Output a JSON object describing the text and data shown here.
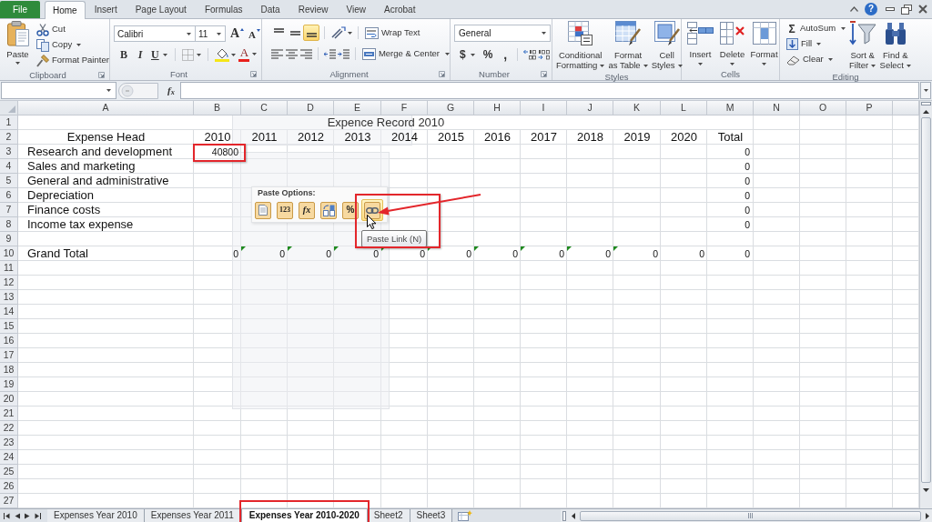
{
  "window_controls": {
    "help": "?"
  },
  "ribbon_tabs": [
    {
      "label": "File",
      "kind": "file",
      "selected": false
    },
    {
      "label": "Home",
      "kind": "tab",
      "selected": true
    },
    {
      "label": "Insert",
      "kind": "tab",
      "selected": false
    },
    {
      "label": "Page Layout",
      "kind": "tab",
      "selected": false
    },
    {
      "label": "Formulas",
      "kind": "tab",
      "selected": false
    },
    {
      "label": "Data",
      "kind": "tab",
      "selected": false
    },
    {
      "label": "Review",
      "kind": "tab",
      "selected": false
    },
    {
      "label": "View",
      "kind": "tab",
      "selected": false
    },
    {
      "label": "Acrobat",
      "kind": "tab",
      "selected": false
    }
  ],
  "ribbon": {
    "clipboard": {
      "label": "Clipboard",
      "paste": "Paste",
      "cut": "Cut",
      "copy": "Copy",
      "format_painter": "Format Painter"
    },
    "font": {
      "label": "Font",
      "font_name": "Calibri",
      "font_size": "11",
      "grow_font": "A",
      "shrink_font": "A",
      "bold": "B",
      "italic": "I",
      "underline": "U",
      "font_color": "A"
    },
    "alignment": {
      "label": "Alignment",
      "vertical_align": [
        {
          "selected": false
        },
        {
          "selected": false
        },
        {
          "selected": true
        }
      ],
      "wrap_text": "Wrap Text",
      "merge_center": "Merge & Center"
    },
    "number": {
      "label": "Number",
      "format": "General",
      "currency": "$",
      "percent": "%",
      "comma": ","
    },
    "styles": {
      "label": "Styles",
      "buttons": [
        {
          "lines": [
            "Conditional",
            "Formatting"
          ]
        },
        {
          "lines": [
            "Format",
            "as Table"
          ]
        },
        {
          "lines": [
            "Cell",
            "Styles"
          ]
        }
      ]
    },
    "cells": {
      "label": "Cells",
      "buttons": [
        "Insert",
        "Delete",
        "Format"
      ]
    },
    "editing": {
      "label": "Editing",
      "autosum_symbol": "Σ",
      "autosum": "AutoSum",
      "fill": "Fill",
      "clear": "Clear",
      "buttons": [
        {
          "lines": [
            "Sort &",
            "Filter"
          ]
        },
        {
          "lines": [
            "Find &",
            "Select"
          ]
        }
      ]
    }
  },
  "formula_bar": {
    "function_button": "f$_{x}$"
  },
  "sheet": {
    "columns": [
      "A",
      "B",
      "C",
      "D",
      "E",
      "F",
      "G",
      "H",
      "I",
      "J",
      "K",
      "L",
      "M",
      "N",
      "O",
      "P"
    ],
    "rows": [
      {
        "header": "1",
        "kind": "title",
        "title": "Expence Record 2010"
      },
      {
        "header": "2",
        "kind": "heading",
        "label": "Expense Head",
        "values": [
          {
            "text": "2010",
            "flagged": false,
            "highlighted": false
          },
          {
            "text": "2011",
            "flagged": false,
            "highlighted": false
          },
          {
            "text": "2012",
            "flagged": false,
            "highlighted": false
          },
          {
            "text": "2013",
            "flagged": false,
            "highlighted": false
          },
          {
            "text": "2014",
            "flagged": false,
            "highlighted": false
          },
          {
            "text": "2015",
            "flagged": false,
            "highlighted": false
          },
          {
            "text": "2016",
            "flagged": false,
            "highlighted": false
          },
          {
            "text": "2017",
            "flagged": false,
            "highlighted": false
          },
          {
            "text": "2018",
            "flagged": false,
            "highlighted": false
          },
          {
            "text": "2019",
            "flagged": false,
            "highlighted": false
          },
          {
            "text": "2020",
            "flagged": false,
            "highlighted": false
          }
        ],
        "total": "Total"
      },
      {
        "header": "3",
        "kind": "item",
        "label": "Research and development",
        "values": [
          {
            "text": "40800",
            "flagged": false,
            "highlighted": true
          }
        ],
        "total": "0"
      },
      {
        "header": "4",
        "kind": "item",
        "label": "Sales and marketing",
        "total": "0"
      },
      {
        "header": "5",
        "kind": "item",
        "label": "General and administrative",
        "total": "0"
      },
      {
        "header": "6",
        "kind": "item",
        "label": "Depreciation",
        "total": "0"
      },
      {
        "header": "7",
        "kind": "item",
        "label": "Finance costs",
        "total": "0"
      },
      {
        "header": "8",
        "kind": "item",
        "label": "Income tax expense",
        "total": "0"
      },
      {
        "header": "9"
      },
      {
        "header": "10",
        "kind": "item",
        "label": "Grand Total",
        "values": [
          {
            "text": "0",
            "flagged": false,
            "highlighted": false
          },
          {
            "text": "0",
            "flagged": true,
            "highlighted": false
          },
          {
            "text": "0",
            "flagged": true,
            "highlighted": false
          },
          {
            "text": "0",
            "flagged": true,
            "highlighted": false
          },
          {
            "text": "0",
            "flagged": true,
            "highlighted": false
          },
          {
            "text": "0",
            "flagged": true,
            "highlighted": false
          },
          {
            "text": "0",
            "flagged": true,
            "highlighted": false
          },
          {
            "text": "0",
            "flagged": true,
            "highlighted": false
          },
          {
            "text": "0",
            "flagged": true,
            "highlighted": false
          },
          {
            "text": "0",
            "flagged": true,
            "highlighted": false
          },
          {
            "text": "0",
            "flagged": false,
            "highlighted": false
          }
        ],
        "total": "0"
      },
      {
        "header": "11"
      },
      {
        "header": "12"
      },
      {
        "header": "13"
      },
      {
        "header": "14"
      },
      {
        "header": "15"
      },
      {
        "header": "16"
      },
      {
        "header": "17"
      },
      {
        "header": "18"
      },
      {
        "header": "19"
      },
      {
        "header": "20"
      },
      {
        "header": "21"
      },
      {
        "header": "22"
      },
      {
        "header": "23"
      },
      {
        "header": "24"
      },
      {
        "header": "25"
      },
      {
        "header": "26"
      },
      {
        "header": "27"
      }
    ]
  },
  "paste_options": {
    "title": "Paste Options:",
    "items": [
      {
        "hovered": false,
        "highlighted": false
      },
      {
        "glyph": "123",
        "hovered": false,
        "highlighted": false
      },
      {
        "glyph": "fx",
        "hovered": false,
        "highlighted": false
      },
      {
        "hovered": false,
        "highlighted": false
      },
      {
        "glyph": "%",
        "hovered": false,
        "highlighted": false
      },
      {
        "hovered": true,
        "highlighted": true,
        "tooltip": "Paste Link (N)"
      }
    ]
  },
  "sheet_tabs": [
    {
      "label": "Expenses Year 2010",
      "selected": false,
      "highlighted": false
    },
    {
      "label": "Expenses Year 2011",
      "selected": false,
      "highlighted": false
    },
    {
      "label": "Expenses Year 2010-2020",
      "selected": true,
      "highlighted": true
    },
    {
      "label": "Sheet2",
      "selected": false,
      "highlighted": false
    },
    {
      "label": "Sheet3",
      "selected": false,
      "highlighted": false
    }
  ]
}
